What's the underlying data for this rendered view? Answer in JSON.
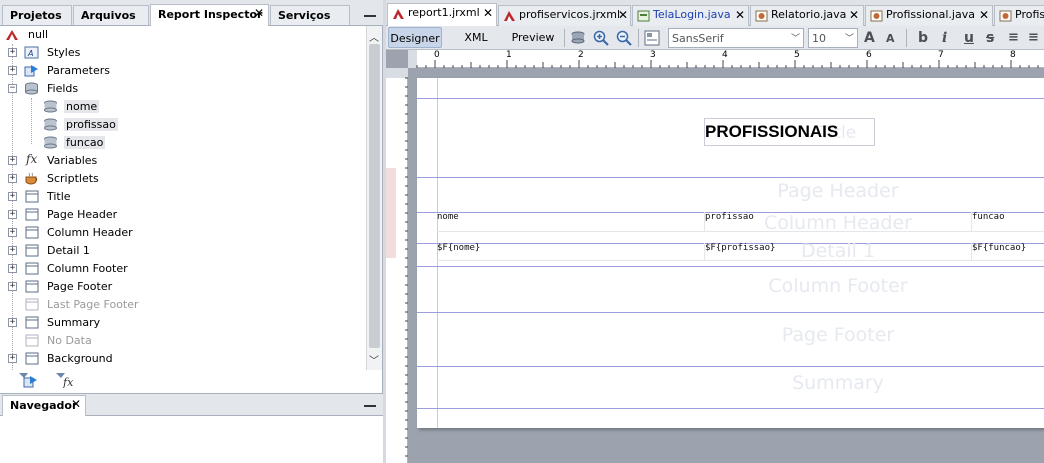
{
  "left_tabs": [
    "Projetos",
    "Arquivos",
    "Report Inspector",
    "Serviços"
  ],
  "tree": {
    "root": "null",
    "items": [
      {
        "label": "Styles",
        "icon": "styles-icon"
      },
      {
        "label": "Parameters",
        "icon": "parameters-icon"
      },
      {
        "label": "Fields",
        "icon": "fields-icon"
      },
      {
        "label": "nome",
        "icon": "field-icon"
      },
      {
        "label": "profissao",
        "icon": "field-icon"
      },
      {
        "label": "funcao",
        "icon": "field-icon"
      },
      {
        "label": "Variables",
        "icon": "variables-icon"
      },
      {
        "label": "Scriptlets",
        "icon": "scriptlets-icon"
      },
      {
        "label": "Title",
        "icon": "band-icon"
      },
      {
        "label": "Page Header",
        "icon": "band-icon"
      },
      {
        "label": "Column Header",
        "icon": "band-icon"
      },
      {
        "label": "Detail 1",
        "icon": "band-icon"
      },
      {
        "label": "Column Footer",
        "icon": "band-icon"
      },
      {
        "label": "Page Footer",
        "icon": "band-icon"
      },
      {
        "label": "Last Page Footer",
        "icon": "band-icon"
      },
      {
        "label": "Summary",
        "icon": "band-icon"
      },
      {
        "label": "No Data",
        "icon": "band-icon"
      },
      {
        "label": "Background",
        "icon": "band-icon"
      }
    ]
  },
  "navigator_tab": "Navegador",
  "editor_tabs": [
    {
      "label": "report1.jrxml",
      "color": "#000000"
    },
    {
      "label": "profiservicos.jrxml",
      "color": "#000000"
    },
    {
      "label": "TelaLogin.java",
      "color": "#1a3fb0"
    },
    {
      "label": "Relatorio.java",
      "color": "#000000"
    },
    {
      "label": "Profissional.java",
      "color": "#000000"
    },
    {
      "label": "Profis",
      "color": "#000000"
    }
  ],
  "view_modes": [
    "Designer",
    "XML",
    "Preview"
  ],
  "font_name": "SansSerif",
  "font_size": "10",
  "ruler_numbers": [
    "0",
    "1",
    "2",
    "3",
    "4",
    "5",
    "6",
    "7",
    "8"
  ],
  "report": {
    "title_text": "PROFISSIONAIS",
    "title_band_faint": "Title",
    "bands": [
      "Page Header",
      "Column Header",
      "Detail 1",
      "Column Footer",
      "Page Footer",
      "Summary"
    ],
    "column_headers": [
      "nome",
      "profissao",
      "funcao"
    ],
    "detail_fields": [
      "$F{nome}",
      "$F{profissao}",
      "$F{funcao}"
    ]
  }
}
